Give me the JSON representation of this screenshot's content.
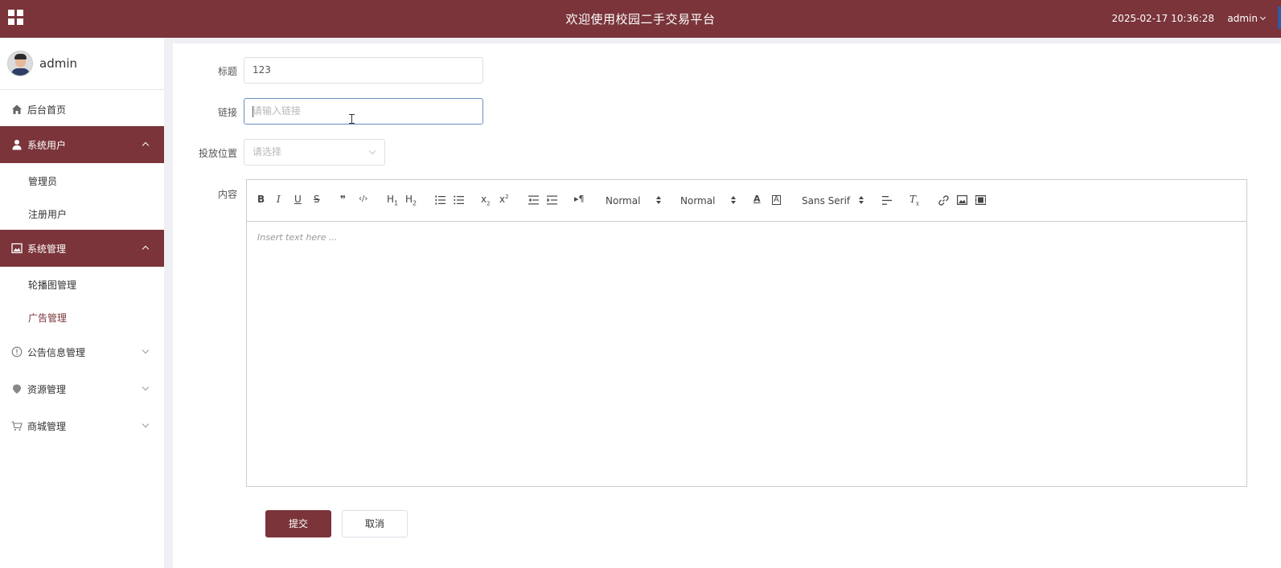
{
  "header": {
    "title": "欢迎使用校园二手交易平台",
    "datetime": "2025-02-17 10:36:28",
    "user": "admin",
    "menu_icon": "grid-icon",
    "color": "#7a343a"
  },
  "sidebar": {
    "user_name": "admin",
    "items": [
      {
        "label": "后台首页",
        "icon": "home-icon"
      },
      {
        "label": "系统用户",
        "icon": "user-icon",
        "expanded": true,
        "children": [
          "管理员",
          "注册用户"
        ]
      },
      {
        "label": "系统管理",
        "icon": "image-icon",
        "expanded": true,
        "children": [
          "轮播图管理",
          "广告管理"
        ]
      },
      {
        "label": "公告信息管理",
        "icon": "info-icon"
      },
      {
        "label": "资源管理",
        "icon": "pin-icon"
      },
      {
        "label": "商城管理",
        "icon": "cart-icon"
      }
    ],
    "current": "广告管理"
  },
  "form": {
    "title_label": "标题",
    "title_value": "123",
    "link_label": "链接",
    "link_placeholder": "请输入链接",
    "position_label": "投放位置",
    "position_placeholder": "请选择",
    "content_label": "内容"
  },
  "editor": {
    "header_picker": "Normal",
    "size_picker": "Normal",
    "font_picker": "Sans Serif",
    "placeholder": "Insert text here ..."
  },
  "buttons": {
    "submit": "提交",
    "cancel": "取消"
  }
}
